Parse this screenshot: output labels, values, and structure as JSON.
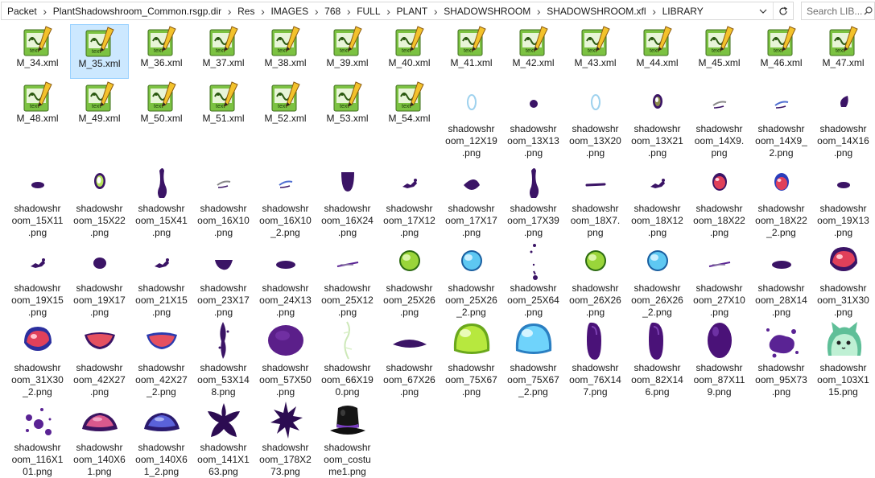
{
  "address_bar": {
    "crumbs": [
      "Packet",
      "PlantShadowshroom_Common.rsgp.dir",
      "Res",
      "IMAGES",
      "768",
      "FULL",
      "PLANT",
      "SHADOWSHROOM",
      "SHADOWSHROOM.xfl",
      "LIBRARY"
    ],
    "dropdown_icon": "chevron-down-icon",
    "refresh_icon": "refresh-icon"
  },
  "search": {
    "placeholder": "Search LIB...",
    "icon": "search-icon"
  },
  "selected_item": "M_35.xml",
  "files": [
    {
      "name": "M_34.xml",
      "kind": "xml"
    },
    {
      "name": "M_35.xml",
      "kind": "xml"
    },
    {
      "name": "M_36.xml",
      "kind": "xml"
    },
    {
      "name": "M_37.xml",
      "kind": "xml"
    },
    {
      "name": "M_38.xml",
      "kind": "xml"
    },
    {
      "name": "M_39.xml",
      "kind": "xml"
    },
    {
      "name": "M_40.xml",
      "kind": "xml"
    },
    {
      "name": "M_41.xml",
      "kind": "xml"
    },
    {
      "name": "M_42.xml",
      "kind": "xml"
    },
    {
      "name": "M_43.xml",
      "kind": "xml"
    },
    {
      "name": "M_44.xml",
      "kind": "xml"
    },
    {
      "name": "M_45.xml",
      "kind": "xml"
    },
    {
      "name": "M_46.xml",
      "kind": "xml"
    },
    {
      "name": "M_47.xml",
      "kind": "xml"
    },
    {
      "name": "M_48.xml",
      "kind": "xml"
    },
    {
      "name": "M_49.xml",
      "kind": "xml"
    },
    {
      "name": "M_50.xml",
      "kind": "xml"
    },
    {
      "name": "M_51.xml",
      "kind": "xml"
    },
    {
      "name": "M_52.xml",
      "kind": "xml"
    },
    {
      "name": "M_53.xml",
      "kind": "xml"
    },
    {
      "name": "M_54.xml",
      "kind": "xml"
    },
    {
      "name": "shadowshr\noom_12X19\n.png",
      "kind": "ring"
    },
    {
      "name": "shadowshr\noom_13X13\n.png",
      "kind": "dot"
    },
    {
      "name": "shadowshr\noom_13X20\n.png",
      "kind": "ring"
    },
    {
      "name": "shadowshr\noom_13X21\n.png",
      "kind": "eye"
    },
    {
      "name": "shadowshr\noom_14X9.\npng",
      "kind": "wisp-grey"
    },
    {
      "name": "shadowshr\noom_14X9_\n2.png",
      "kind": "wisp-blue"
    },
    {
      "name": "shadowshr\noom_14X16\n.png",
      "kind": "tear"
    },
    {
      "name": "shadowshr\noom_15X11\n.png",
      "kind": "small-blob"
    },
    {
      "name": "shadowshr\noom_15X22\n.png",
      "kind": "eye-green"
    },
    {
      "name": "shadowshr\noom_15X41\n.png",
      "kind": "stalk"
    },
    {
      "name": "shadowshr\noom_16X10\n.png",
      "kind": "wisp-grey"
    },
    {
      "name": "shadowshr\noom_16X10\n_2.png",
      "kind": "wisp-blue"
    },
    {
      "name": "shadowshr\noom_16X24\n.png",
      "kind": "cup"
    },
    {
      "name": "shadowshr\noom_17X12\n.png",
      "kind": "splat-small"
    },
    {
      "name": "shadowshr\noom_17X17\n.png",
      "kind": "half-blob"
    },
    {
      "name": "shadowshr\noom_17X39\n.png",
      "kind": "stalk"
    },
    {
      "name": "shadowshr\noom_18X7.\npng",
      "kind": "line"
    },
    {
      "name": "shadowshr\noom_18X12\n.png",
      "kind": "splat-small"
    },
    {
      "name": "shadowshr\noom_18X22\n.png",
      "kind": "red-cap"
    },
    {
      "name": "shadowshr\noom_18X22\n_2.png",
      "kind": "red-cap-blue"
    },
    {
      "name": "shadowshr\noom_19X13\n.png",
      "kind": "small-blob"
    },
    {
      "name": "shadowshr\noom_19X15\n.png",
      "kind": "splat-small"
    },
    {
      "name": "shadowshr\noom_19X17\n.png",
      "kind": "dot-big"
    },
    {
      "name": "shadowshr\noom_21X15\n.png",
      "kind": "splat-small"
    },
    {
      "name": "shadowshr\noom_23X17\n.png",
      "kind": "bowl"
    },
    {
      "name": "shadowshr\noom_24X13\n.png",
      "kind": "flat-oval"
    },
    {
      "name": "shadowshr\noom_25X12\n.png",
      "kind": "streak"
    },
    {
      "name": "shadowshr\noom_25X26\n.png",
      "kind": "green-ball"
    },
    {
      "name": "shadowshr\noom_25X26\n_2.png",
      "kind": "blue-ball"
    },
    {
      "name": "shadowshr\noom_25X64\n.png",
      "kind": "drips"
    },
    {
      "name": "shadowshr\noom_26X26\n.png",
      "kind": "green-ball"
    },
    {
      "name": "shadowshr\noom_26X26\n_2.png",
      "kind": "blue-ball"
    },
    {
      "name": "shadowshr\noom_27X10\n.png",
      "kind": "streak"
    },
    {
      "name": "shadowshr\noom_28X14\n.png",
      "kind": "flat-oval"
    },
    {
      "name": "shadowshr\noom_31X30\n.png",
      "kind": "red-mushroom"
    },
    {
      "name": "shadowshr\noom_31X30\n_2.png",
      "kind": "red-mushroom-blue"
    },
    {
      "name": "shadowshr\noom_42X27\n.png",
      "kind": "red-lip"
    },
    {
      "name": "shadowshr\noom_42X27\n_2.png",
      "kind": "red-lip-blue"
    },
    {
      "name": "shadowshr\noom_53X14\n8.png",
      "kind": "tall-splat"
    },
    {
      "name": "shadowshr\noom_57X50\n.png",
      "kind": "big-blob"
    },
    {
      "name": "shadowshr\noom_66X19\n0.png",
      "kind": "faint-vine"
    },
    {
      "name": "shadowshr\noom_67X26\n.png",
      "kind": "puddle"
    },
    {
      "name": "shadowshr\noom_75X67\n.png",
      "kind": "green-jelly"
    },
    {
      "name": "shadowshr\noom_75X67\n_2.png",
      "kind": "blue-jelly"
    },
    {
      "name": "shadowshr\noom_76X14\n7.png",
      "kind": "bean"
    },
    {
      "name": "shadowshr\noom_82X14\n6.png",
      "kind": "bean"
    },
    {
      "name": "shadowshr\noom_87X11\n9.png",
      "kind": "egg"
    },
    {
      "name": "shadowshr\noom_95X73\n.png",
      "kind": "spatter"
    },
    {
      "name": "shadowshr\noom_103X1\n15.png",
      "kind": "cat"
    },
    {
      "name": "shadowshr\noom_116X1\n01.png",
      "kind": "spatter-small"
    },
    {
      "name": "shadowshr\noom_140X6\n1.png",
      "kind": "cap-pink"
    },
    {
      "name": "shadowshr\noom_140X6\n1_2.png",
      "kind": "cap-blue"
    },
    {
      "name": "shadowshr\noom_141X1\n63.png",
      "kind": "starfish"
    },
    {
      "name": "shadowshr\noom_178X2\n73.png",
      "kind": "burst"
    },
    {
      "name": "shadowshr\noom_costu\nme1.png",
      "kind": "hat"
    }
  ],
  "colors": {
    "selection_bg": "#cce8ff",
    "selection_border": "#99d1ff",
    "shadow_purple": "#3b1466",
    "accent_red": "#e0405a",
    "accent_green": "#9ad53a",
    "accent_blue": "#5ec8f2"
  }
}
